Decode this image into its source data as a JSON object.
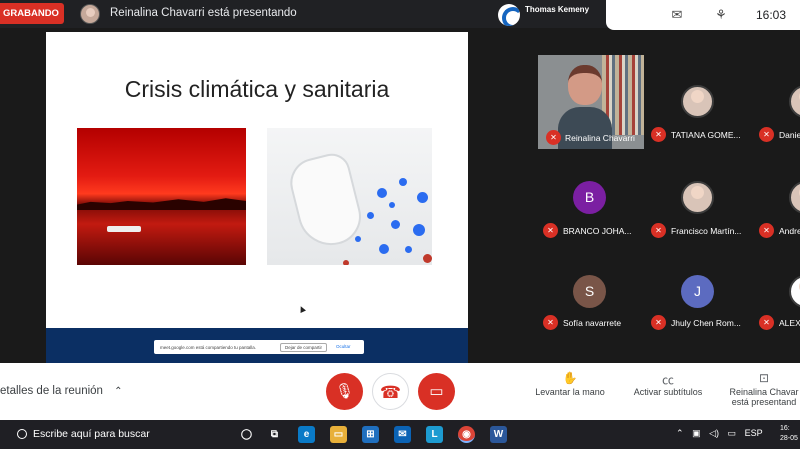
{
  "topbar": {
    "recording_label": "GRABANDO",
    "presenting_text": "Reinalina Chavarri está presentando",
    "active_speaker": "Thomas Kemeny",
    "clock": "16:03"
  },
  "slide": {
    "title": "Crisis climática y sanitaria",
    "share_bar": {
      "message": "meet.google.com está compartiendo tu pantalla.",
      "stop_label": "Dejar de compartir",
      "hide_label": "Ocultar"
    }
  },
  "participants": [
    {
      "name": "Reinalina Chavarri",
      "type": "video",
      "muted": true
    },
    {
      "name": "TATIANA GOME...",
      "type": "photo",
      "muted": true
    },
    {
      "name": "Danie",
      "type": "photo",
      "muted": true
    },
    {
      "name": "BRANCO JOHA...",
      "type": "initial",
      "initial": "B",
      "color": "#7b1fa2",
      "muted": true
    },
    {
      "name": "Francisco Martín...",
      "type": "photo",
      "muted": true
    },
    {
      "name": "Andre",
      "type": "photo",
      "muted": true
    },
    {
      "name": "Sofía navarrete",
      "type": "initial",
      "initial": "S",
      "color": "#795548",
      "muted": true
    },
    {
      "name": "Jhuly Chen Rom...",
      "type": "initial",
      "initial": "J",
      "color": "#5c6bc0",
      "muted": true
    },
    {
      "name": "ALEX",
      "type": "photo",
      "muted": true
    }
  ],
  "controls": {
    "details_label": "etalles de la reunión",
    "raise_hand": "Levantar la mano",
    "captions": "Activar subtítulos",
    "presenter_line1": "Reinalina Chavar",
    "presenter_line2": "está presentand"
  },
  "taskbar": {
    "search_placeholder": "Escribe aquí para buscar",
    "language": "ESP",
    "time": "16:",
    "date": "28-05"
  }
}
